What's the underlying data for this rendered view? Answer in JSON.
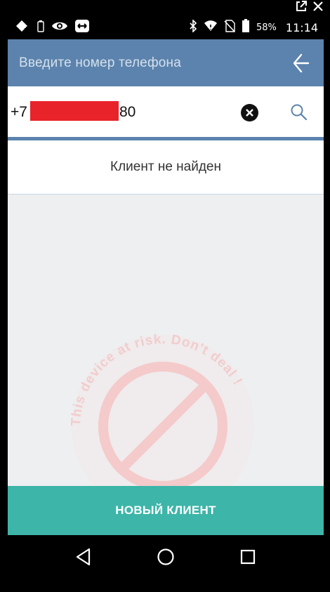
{
  "status_bar": {
    "battery_percent": "58%",
    "time": "11:14",
    "icons": [
      "cellular-data-icon",
      "battery-small-icon",
      "eye-icon",
      "teamviewer-icon",
      "bluetooth-icon",
      "wifi-icon",
      "no-sim-icon",
      "battery-icon"
    ]
  },
  "window_controls": [
    "popout-icon",
    "close-icon"
  ],
  "header": {
    "title": "Введите номер телефона",
    "back_icon": "back-arrow-icon"
  },
  "search": {
    "phone_prefix": "+7",
    "phone_suffix": "80",
    "redaction_color": "#e8232a",
    "clear_icon": "clear-icon",
    "search_icon": "search-icon"
  },
  "result": {
    "message": "Клиент не найден"
  },
  "watermark": {
    "text": "This device at risk. Don't deal !"
  },
  "actions": {
    "new_client_label": "НОВЫЙ КЛИЕНТ"
  },
  "nav": {
    "icons": [
      "nav-back-icon",
      "nav-home-icon",
      "nav-recents-icon"
    ]
  },
  "colors": {
    "appbar": "#5b83ad",
    "accent_button": "#3db5a8",
    "background": "#eeeff1",
    "watermark_red": "#e03a3a"
  }
}
